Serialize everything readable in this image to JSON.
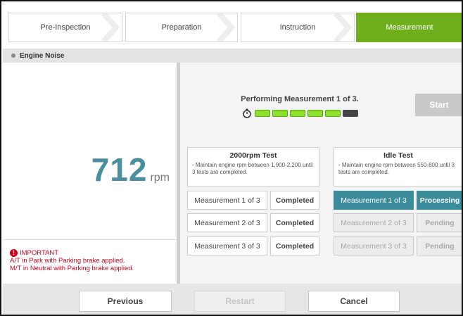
{
  "steps": [
    {
      "label": "Pre-Inspection",
      "active": false
    },
    {
      "label": "Preparation",
      "active": false
    },
    {
      "label": "Instruction",
      "active": false
    },
    {
      "label": "Measurement",
      "active": true
    }
  ],
  "section": {
    "title": "Engine Noise"
  },
  "reading": {
    "value": "712",
    "unit": "rpm"
  },
  "important": {
    "title": "IMPORTANT",
    "lines": [
      "A/T in Park with Parking brake applied.",
      "M/T in Neutral with Parking brake applied."
    ]
  },
  "status": {
    "text": "Performing Measurement 1 of 3.",
    "progress_segments": 6,
    "progress_filled": 5
  },
  "start_button": "Start",
  "tests": [
    {
      "title": "2000rpm Test",
      "description": "- Maintain engine rpm between 1,900-2,200 until 3 tests are completed.",
      "rows": [
        {
          "label": "Measurement 1 of 3",
          "status": "Completed"
        },
        {
          "label": "Measurement 2 of 3",
          "status": "Completed"
        },
        {
          "label": "Measurement 3 of 3",
          "status": "Completed"
        }
      ]
    },
    {
      "title": "Idle Test",
      "description": "- Maintain engine rpm between 550-800 until 3 tests are completed.",
      "rows": [
        {
          "label": "Measurement 1 of 3",
          "status": "Processing"
        },
        {
          "label": "Measurement 2 of 3",
          "status": "Pending"
        },
        {
          "label": "Measurement 3 of 3",
          "status": "Pending"
        }
      ]
    }
  ],
  "footer": {
    "previous": "Previous",
    "restart": "Restart",
    "cancel": "Cancel"
  },
  "colors": {
    "accent_green": "#6fae1d",
    "teal": "#3b8d9c",
    "rpm": "#4a8fa0",
    "progress_on": "#8ee02a",
    "progress_off": "#444444",
    "warning": "#d0021b"
  }
}
